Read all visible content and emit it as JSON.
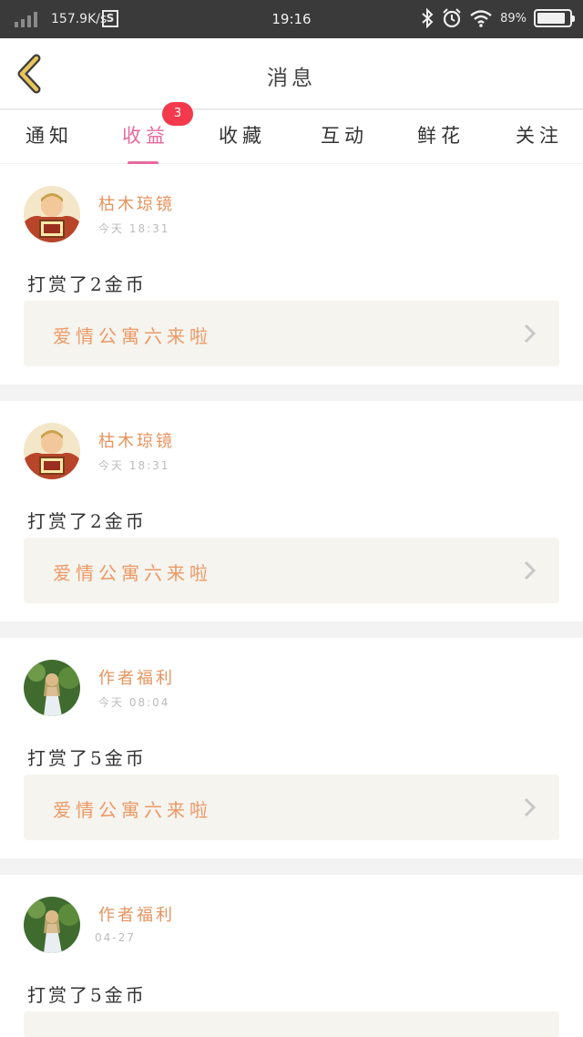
{
  "status_bar": {
    "net_speed": "157.9K/s",
    "s_icon_text": "S",
    "time": "19:16",
    "battery_pct": "89%",
    "battery_level": 0.89,
    "icons": [
      "signal-icon",
      "bluetooth-icon",
      "alarm-icon",
      "wifi-icon",
      "battery-icon"
    ]
  },
  "header": {
    "title": "消息",
    "back_icon": "back-chevron-icon"
  },
  "tabs": {
    "items": [
      {
        "label": "通知"
      },
      {
        "label": "收益"
      },
      {
        "label": "收藏"
      },
      {
        "label": "互动"
      },
      {
        "label": "鲜花"
      },
      {
        "label": "关注"
      }
    ],
    "active_index": 1,
    "badge": "3"
  },
  "messages": [
    {
      "username": "枯木琼镜",
      "time": "今天 18:31",
      "text": "打赏了2金币",
      "book": "爱情公寓六来啦",
      "avatar": "monk-avatar"
    },
    {
      "username": "枯木琼镜",
      "time": "今天 18:31",
      "text": "打赏了2金币",
      "book": "爱情公寓六来啦",
      "avatar": "monk-avatar"
    },
    {
      "username": "作者福利",
      "time": "今天 08:04",
      "text": "打赏了5金币",
      "book": "爱情公寓六来啦",
      "avatar": "girl-avatar"
    },
    {
      "username": "作者福利",
      "time": "04-27",
      "text": "打赏了5金币",
      "book": "",
      "avatar": "girl-avatar"
    }
  ],
  "colors": {
    "accent": "#e8689c",
    "badge": "#f23a4c",
    "username": "#e6935e",
    "book_title": "#ec9966",
    "back_chevron": "#e7c55a"
  }
}
